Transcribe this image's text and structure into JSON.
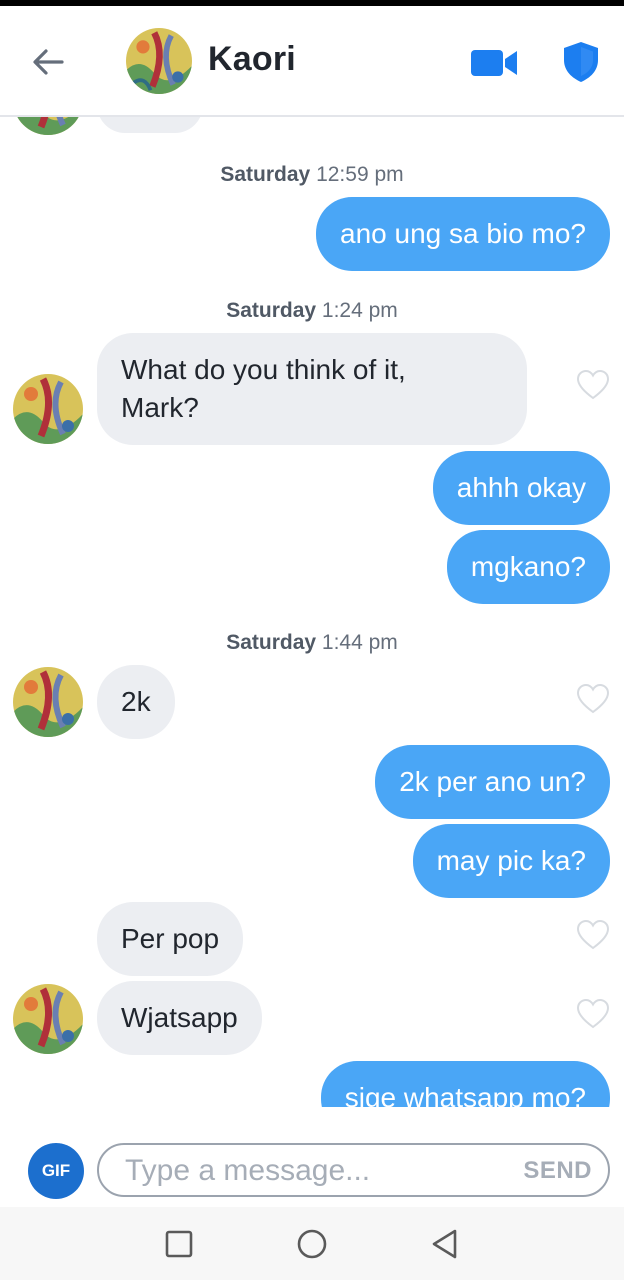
{
  "header": {
    "contact_name": "Kaori",
    "back_icon": "arrow-left-icon",
    "video_icon": "video-camera-icon",
    "safety_icon": "shield-icon",
    "accent_color": "#1c7ef0"
  },
  "thread": {
    "timestamps": [
      {
        "day": "Saturday",
        "time": "12:59 pm"
      },
      {
        "day": "Saturday",
        "time": "1:24 pm"
      },
      {
        "day": "Saturday",
        "time": "1:44 pm"
      }
    ],
    "messages": [
      {
        "from": "me",
        "text": "ano ung sa bio mo?"
      },
      {
        "from": "them",
        "text": "What do you think of it,\nMark?"
      },
      {
        "from": "me",
        "text": "ahhh okay"
      },
      {
        "from": "me",
        "text": "mgkano?"
      },
      {
        "from": "them",
        "text": "2k"
      },
      {
        "from": "me",
        "text": "2k per ano un?"
      },
      {
        "from": "me",
        "text": "may pic ka?"
      },
      {
        "from": "them",
        "text": "Per pop"
      },
      {
        "from": "them",
        "text": "Wjatsapp"
      },
      {
        "from": "me",
        "text": "sige whatsapp mo?"
      }
    ],
    "sent_color": "#4aa6f6",
    "received_color": "#eceef2"
  },
  "composer": {
    "gif_label": "GIF",
    "placeholder": "Type a message...",
    "value": "",
    "send_label": "SEND"
  },
  "navbar": {
    "icons": [
      "square-recents-icon",
      "circle-home-icon",
      "triangle-back-icon"
    ]
  }
}
